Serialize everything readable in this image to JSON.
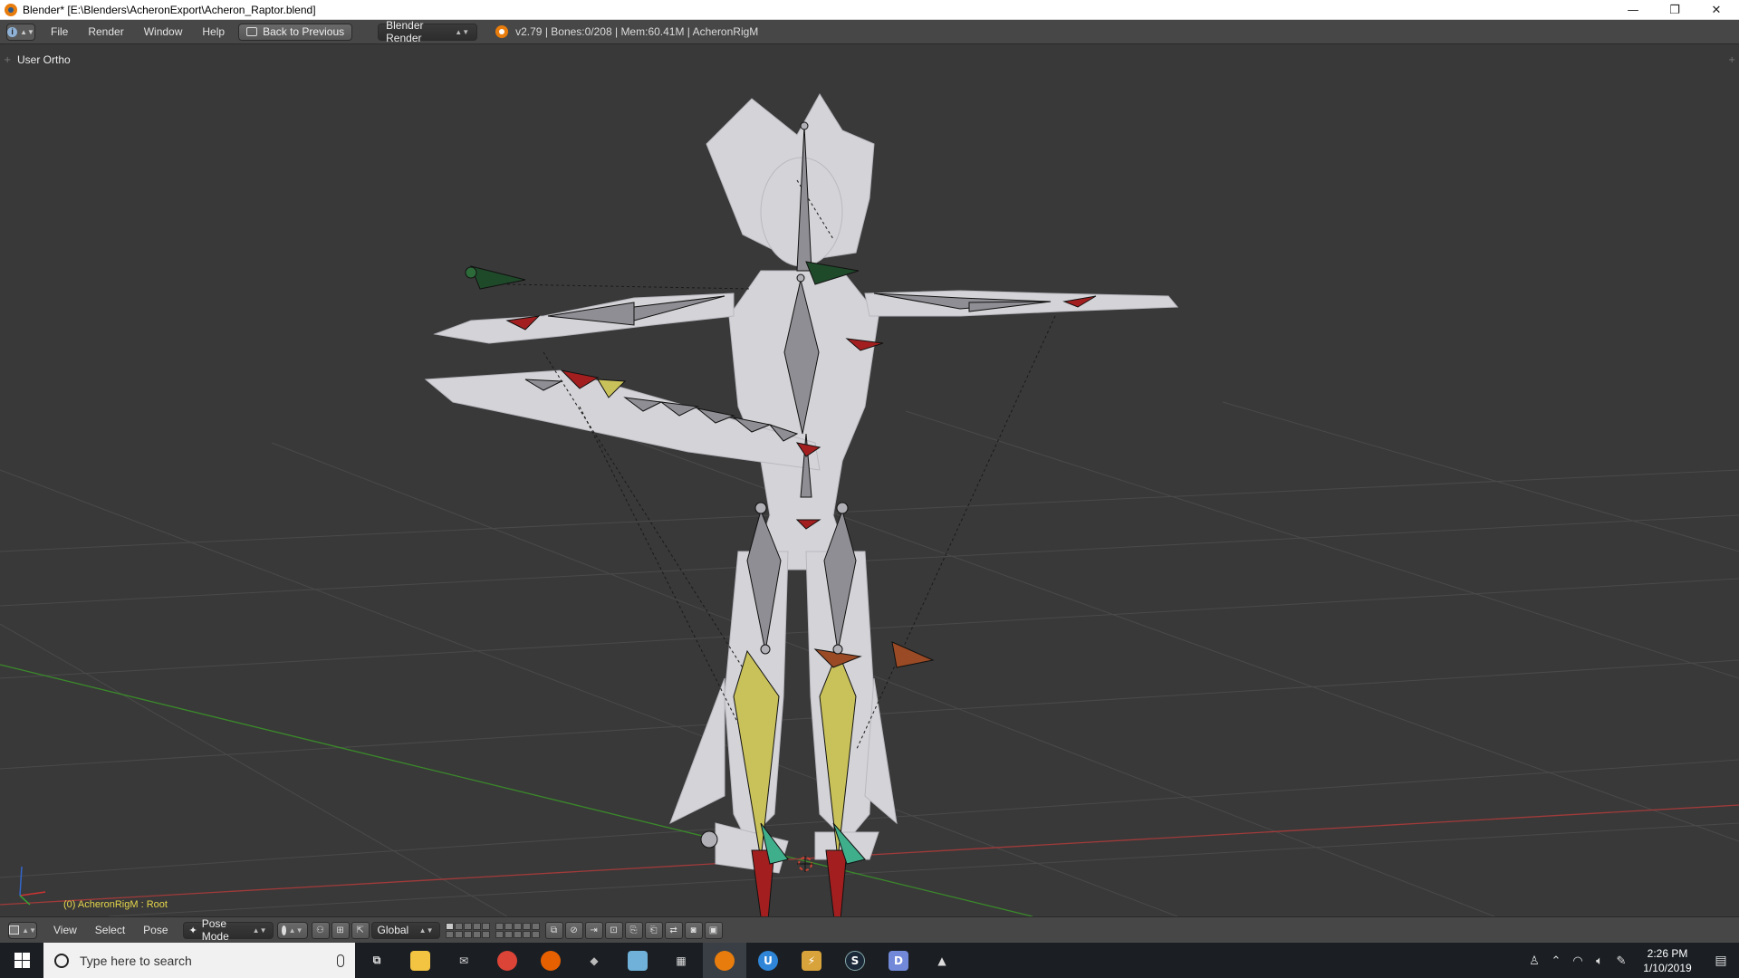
{
  "window": {
    "title": "Blender* [E:\\Blenders\\AcheronExport\\Acheron_Raptor.blend]",
    "minimize": "—",
    "restore": "❐",
    "close": "✕"
  },
  "infobar": {
    "menus": [
      "File",
      "Render",
      "Window",
      "Help"
    ],
    "back_button": "Back to Previous",
    "render_engine": "Blender Render",
    "stats": "v2.79 | Bones:0/208 | Mem:60.41M | AcheronRigM"
  },
  "viewport": {
    "view_name": "User Ortho",
    "active_object": "(0) AcheronRigM : Root"
  },
  "view_header": {
    "menus": [
      "View",
      "Select",
      "Pose"
    ],
    "mode": "Pose Mode",
    "orientation": "Global"
  },
  "taskbar": {
    "search_placeholder": "Type here to search",
    "apps": [
      {
        "name": "task-view",
        "label": "⧉",
        "color": "#1b1f24"
      },
      {
        "name": "file-explorer",
        "label": "📁",
        "color": "#f3c342"
      },
      {
        "name": "mail",
        "label": "✉",
        "color": "#4a4f57"
      },
      {
        "name": "chrome",
        "label": "●",
        "color": "#db4437"
      },
      {
        "name": "firefox",
        "label": "●",
        "color": "#e66000"
      },
      {
        "name": "steam-like",
        "label": "◆",
        "color": "#3b4048"
      },
      {
        "name": "notepad",
        "label": "▱",
        "color": "#6fb1d8"
      },
      {
        "name": "calculator",
        "label": "▦",
        "color": "#3b4048"
      },
      {
        "name": "blender",
        "label": "◉",
        "color": "#e87d0d"
      },
      {
        "name": "uplay",
        "label": "U",
        "color": "#2f86d8"
      },
      {
        "name": "winamp",
        "label": "⚡",
        "color": "#d9a33b"
      },
      {
        "name": "steam",
        "label": "S",
        "color": "#1b2838"
      },
      {
        "name": "discord",
        "label": "D",
        "color": "#7289da"
      },
      {
        "name": "photos",
        "label": "▲",
        "color": "#3b4048"
      }
    ],
    "time": "2:26 PM",
    "date": "1/10/2019"
  },
  "colors": {
    "viewport_bg": "#393939",
    "header_bg": "#474747",
    "grid_line": "#4a4a4a",
    "x_axis": "#a13a3a",
    "y_axis": "#3a8a2a",
    "mesh": "#d4d4d8",
    "bone": "#8e8e94",
    "bone_selected_yellow": "#c9c25a",
    "bone_red": "#a31f1f",
    "bone_green": "#1f4a2a",
    "bone_orange": "#9a4a24",
    "bone_teal": "#3fae8a"
  }
}
